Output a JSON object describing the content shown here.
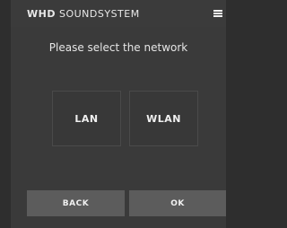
{
  "header": {
    "brand_bold": "WHD",
    "brand_rest": "SOUNDSYSTEM",
    "menu_icon": "hamburger-menu-icon"
  },
  "prompt": "Please select the network",
  "options": {
    "lan_label": "LAN",
    "wlan_label": "WLAN"
  },
  "footer": {
    "back_label": "BACK",
    "ok_label": "OK"
  },
  "colors": {
    "background": "#3a3a3a",
    "button": "#5c5c5c",
    "text": "#f0f0f0"
  }
}
